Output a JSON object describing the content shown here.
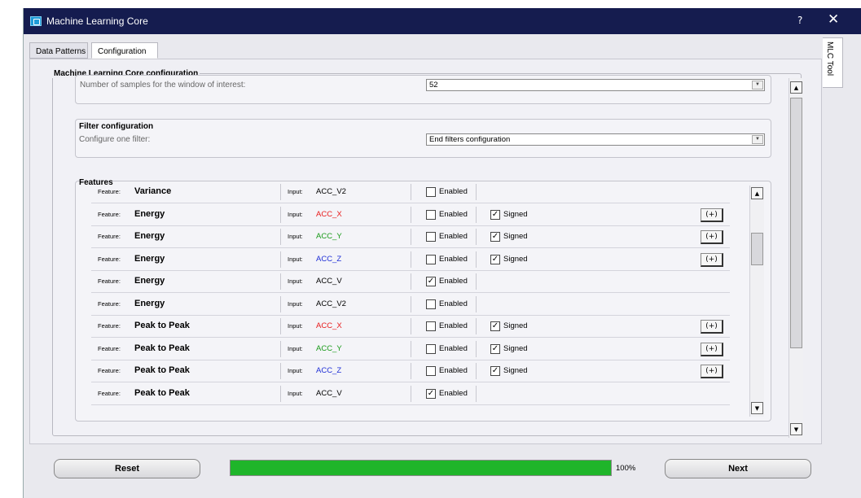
{
  "window": {
    "title": "Machine Learning Core",
    "help": "?",
    "close": "✕"
  },
  "tabs": [
    {
      "label": "Data Patterns",
      "selected": false
    },
    {
      "label": "Configuration",
      "selected": true
    }
  ],
  "side_tab": "MLC Tool",
  "mlc_section": {
    "title": "Machine Learning Core configuration",
    "window_label": "Number of samples for the window of interest:",
    "window_value": "52",
    "filter_title": "Filter configuration",
    "filter_label": "Configure one filter:",
    "filter_value": "End filters configuration",
    "features_title": "Features"
  },
  "features": {
    "feature_label": "Feature:",
    "input_label": "Input:",
    "enabled_label": "Enabled",
    "signed_label": "Signed",
    "plus_label": "(+)",
    "rows": [
      {
        "feature": "Variance",
        "input": "ACC_V2",
        "input_color": "#000000",
        "enabled": false,
        "signed": null
      },
      {
        "feature": "Energy",
        "input": "ACC_X",
        "input_color": "#e81b1b",
        "enabled": false,
        "signed": true
      },
      {
        "feature": "Energy",
        "input": "ACC_Y",
        "input_color": "#1a9a1a",
        "enabled": false,
        "signed": true
      },
      {
        "feature": "Energy",
        "input": "ACC_Z",
        "input_color": "#1f2fd6",
        "enabled": false,
        "signed": true
      },
      {
        "feature": "Energy",
        "input": "ACC_V",
        "input_color": "#000000",
        "enabled": true,
        "signed": null
      },
      {
        "feature": "Energy",
        "input": "ACC_V2",
        "input_color": "#000000",
        "enabled": false,
        "signed": null
      },
      {
        "feature": "Peak to Peak",
        "input": "ACC_X",
        "input_color": "#e81b1b",
        "enabled": false,
        "signed": true
      },
      {
        "feature": "Peak to Peak",
        "input": "ACC_Y",
        "input_color": "#1a9a1a",
        "enabled": false,
        "signed": true
      },
      {
        "feature": "Peak to Peak",
        "input": "ACC_Z",
        "input_color": "#1f2fd6",
        "enabled": false,
        "signed": true
      },
      {
        "feature": "Peak to Peak",
        "input": "ACC_V",
        "input_color": "#000000",
        "enabled": true,
        "signed": null
      }
    ]
  },
  "bottom": {
    "reset_label": "Reset",
    "next_label": "Next",
    "progress_text": "100%",
    "progress": 1.0,
    "progress_color": "#1fb52a"
  }
}
